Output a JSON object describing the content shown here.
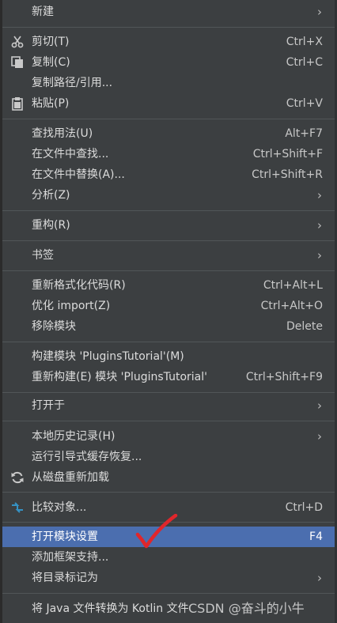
{
  "menu": {
    "new": {
      "label": "新建"
    },
    "cut": {
      "label": "剪切(T)",
      "shortcut": "Ctrl+X",
      "icon": "scissors-icon"
    },
    "copy": {
      "label": "复制(C)",
      "shortcut": "Ctrl+C",
      "icon": "copy-icon"
    },
    "copy_path": {
      "label": "复制路径/引用..."
    },
    "paste": {
      "label": "粘贴(P)",
      "shortcut": "Ctrl+V",
      "icon": "clipboard-icon"
    },
    "find_usages": {
      "label": "查找用法(U)",
      "shortcut": "Alt+F7"
    },
    "find_in_files": {
      "label": "在文件中查找...",
      "shortcut": "Ctrl+Shift+F"
    },
    "replace_in_files": {
      "label": "在文件中替换(A)...",
      "shortcut": "Ctrl+Shift+R"
    },
    "analyze": {
      "label": "分析(Z)"
    },
    "refactor": {
      "label": "重构(R)"
    },
    "bookmarks": {
      "label": "书签"
    },
    "reformat": {
      "label": "重新格式化代码(R)",
      "shortcut": "Ctrl+Alt+L"
    },
    "optimize_imports": {
      "label": "优化 import(Z)",
      "shortcut": "Ctrl+Alt+O"
    },
    "remove_module": {
      "label": "移除模块",
      "shortcut": "Delete"
    },
    "build_module": {
      "label": "构建模块 'PluginsTutorial'(M)"
    },
    "rebuild_module": {
      "label": "重新构建(E) 模块 'PluginsTutorial'",
      "shortcut": "Ctrl+Shift+F9"
    },
    "open_in": {
      "label": "打开于"
    },
    "local_history": {
      "label": "本地历史记录(H)"
    },
    "guided_cache_recovery": {
      "label": "运行引导式缓存恢复..."
    },
    "reload_from_disk": {
      "label": "从磁盘重新加载",
      "icon": "reload-icon"
    },
    "compare_with": {
      "label": "比较对象...",
      "shortcut": "Ctrl+D",
      "icon": "compare-icon"
    },
    "open_module_settings": {
      "label": "打开模块设置",
      "shortcut": "F4"
    },
    "add_framework_support": {
      "label": "添加框架支持..."
    },
    "mark_directory_as": {
      "label": "将目录标记为"
    },
    "convert_java_to_kotlin": {
      "label": "将 Java 文件转换为 Kotlin 文件"
    }
  },
  "submenu_arrow": "›",
  "watermark": "CSDN @奋斗的小牛",
  "colors": {
    "background": "#3c3f41",
    "selected": "#4b6eaf",
    "separator": "#515658",
    "text": "#dcdcdc",
    "annotation_check": "#e0262b"
  }
}
